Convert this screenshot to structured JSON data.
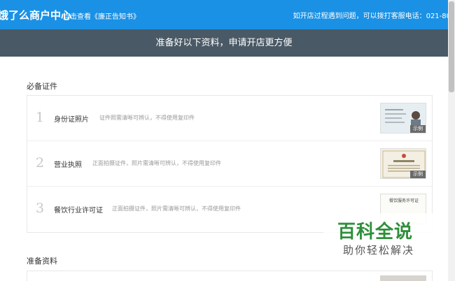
{
  "header": {
    "logo": "饿了么商户中心",
    "notice_link": "点击查看《廉正告知书》",
    "service_text": "如开店过程遇到问题，可以拨打客服电话：021-80"
  },
  "banner": {
    "text": "准备好以下资料，申请开店更方便"
  },
  "required_docs": {
    "title": "必备证件",
    "items": [
      {
        "num": "1",
        "name": "身份证照片",
        "hint": "证件照需清晰可辨认，不得使用复印件",
        "example": "示例"
      },
      {
        "num": "2",
        "name": "营业执照",
        "hint": "正面拍摄证件，照片需清晰可辨认，不得使用复印件",
        "example": "示例"
      },
      {
        "num": "3",
        "name": "餐饮行业许可证",
        "hint": "正面拍摄证件，照片需清晰可辨认，不得使用复印件",
        "thumb_text": "餐饮服务许可证"
      }
    ]
  },
  "prep_docs": {
    "title": "准备资料"
  },
  "watermark": {
    "main": "百科全说",
    "sub": "助你轻松解决"
  },
  "colors": {
    "topbar": "#1a91e5",
    "banner": "#4a5966",
    "watermark": "#2e8f3a"
  }
}
